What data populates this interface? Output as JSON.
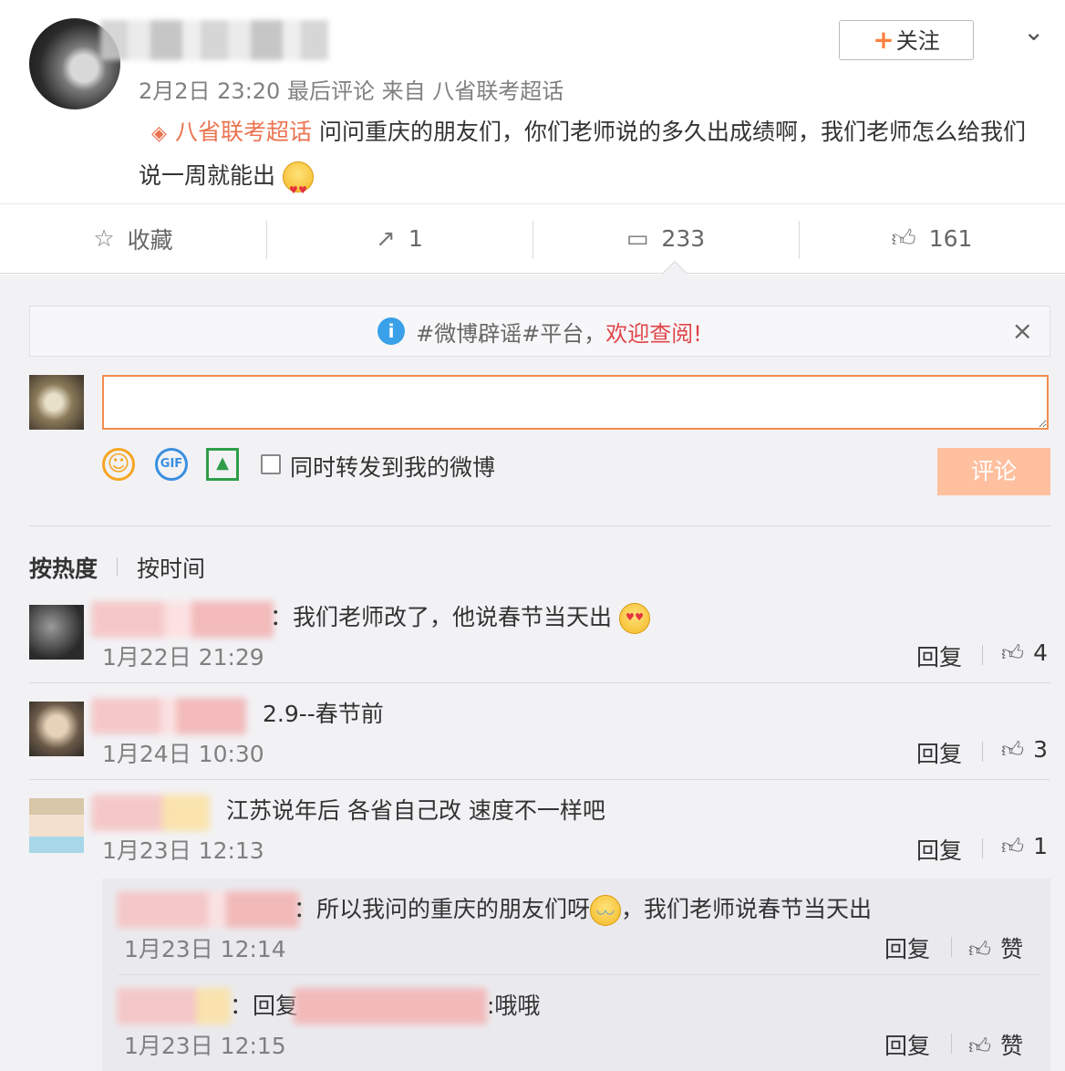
{
  "post": {
    "meta": "2月2日 23:20 最后评论 来自 八省联考超话",
    "topic": "八省联考超话",
    "text": "问问重庆的朋友们，你们老师说的多久出成绩啊，我们老师怎么给我们说一周就能出",
    "follow_label": "关注",
    "follow_plus": "+"
  },
  "actions": {
    "favorite_label": "收藏",
    "repost_count": "1",
    "comment_count": "233",
    "like_count": "161"
  },
  "notice": {
    "text": "#微博辟谣#平台，",
    "welcome": "欢迎查阅!",
    "close": "×"
  },
  "composer": {
    "input_value": "",
    "repost_label": "同时转发到我的微博",
    "submit_label": "评论"
  },
  "sort": {
    "hot": "按热度",
    "time": "按时间"
  },
  "comments": [
    {
      "text": "：我们老师改了，他说春节当天出",
      "time": "1月22日 21:29",
      "reply": "回复",
      "likes": "4"
    },
    {
      "text": "2.9--春节前",
      "time": "1月24日 10:30",
      "reply": "回复",
      "likes": "3"
    },
    {
      "text": "江苏说年后 各省自己改 速度不一样吧",
      "time": "1月23日 12:13",
      "reply": "回复",
      "likes": "1"
    }
  ],
  "sub_comments": [
    {
      "text": "：所以我问的重庆的朋友们呀",
      "text_after": "，我们老师说春节当天出",
      "time": "1月23日 12:14",
      "reply": "回复",
      "like_label": "赞"
    },
    {
      "prefix": "：回复",
      "text": ":哦哦",
      "time": "1月23日 12:15",
      "reply": "回复",
      "like_label": "赞"
    }
  ],
  "icons": {
    "topic": "super-topic-icon",
    "chevron": "chevron-down-icon",
    "favorite": "star-icon",
    "repost": "share-icon",
    "comment": "comment-icon",
    "like": "thumb-up-icon",
    "info": "info-icon",
    "close": "close-icon",
    "emoji": "emoji-icon",
    "gif": "gif-icon",
    "picture": "picture-icon"
  },
  "colors": {
    "accent": "#eb7350",
    "submit_disabled": "#ffc09f",
    "input_border": "#f28c4e",
    "info_blue": "#3aa0e8",
    "welcome_red": "#e0454a"
  }
}
